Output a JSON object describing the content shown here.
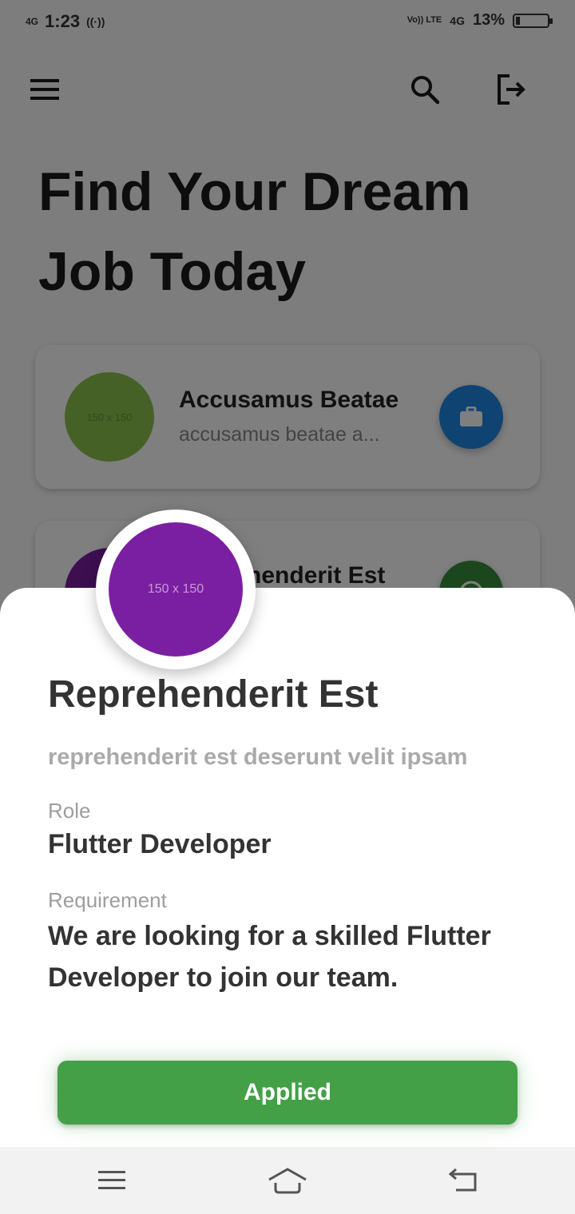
{
  "status_bar": {
    "network_left": "4G",
    "time": "1:23",
    "volte": "Vo)) LTE",
    "network_right": "4G",
    "battery": "13%",
    "battery_level": 0.13
  },
  "header": {
    "title": "Find Your Dream Job Today",
    "menu_icon": "menu-icon",
    "search_icon": "search-icon",
    "logout_icon": "logout-icon"
  },
  "jobs": [
    {
      "title": "Accusamus Beatae",
      "subtitle": "accusamus beatae a...",
      "avatar_text": "150 x 150",
      "avatar_color": "#8bc34a",
      "action_color": "#1e88e5",
      "action_icon": "briefcase-icon"
    },
    {
      "title": "Reprehenderit Est",
      "avatar_color": "#7b1fa2",
      "action_color": "#388e3c",
      "action_icon": "check-circle-icon"
    }
  ],
  "detail": {
    "avatar_text": "150 x 150",
    "avatar_color": "#7b1fa2",
    "title": "Reprehenderit Est",
    "description": "reprehenderit est deserunt velit ipsam",
    "role_label": "Role",
    "role_value": "Flutter Developer",
    "requirement_label": "Requirement",
    "requirement_value": "We are looking for a skilled Flutter Developer to join our team.",
    "button_label": "Applied",
    "button_color": "#43a047"
  },
  "nav_bar": {
    "recent_icon": "recent-apps-icon",
    "home_icon": "home-icon",
    "back_icon": "back-icon"
  }
}
